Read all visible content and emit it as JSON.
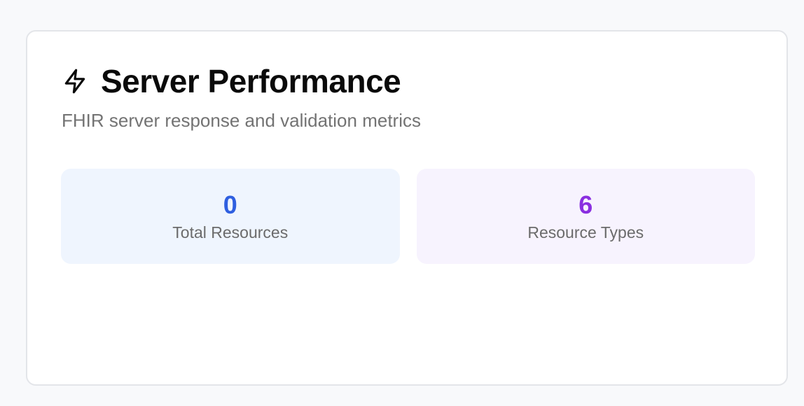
{
  "card": {
    "title": "Server Performance",
    "subtitle": "FHIR server response and validation metrics",
    "icon": "bolt-icon"
  },
  "stats": [
    {
      "value": "0",
      "label": "Total Resources",
      "color": "#2f5fe0"
    },
    {
      "value": "6",
      "label": "Resource Types",
      "color": "#8a2fe0"
    }
  ],
  "colors": {
    "blue_tile": "#eff5fe",
    "purple_tile": "#f7f3fe"
  }
}
